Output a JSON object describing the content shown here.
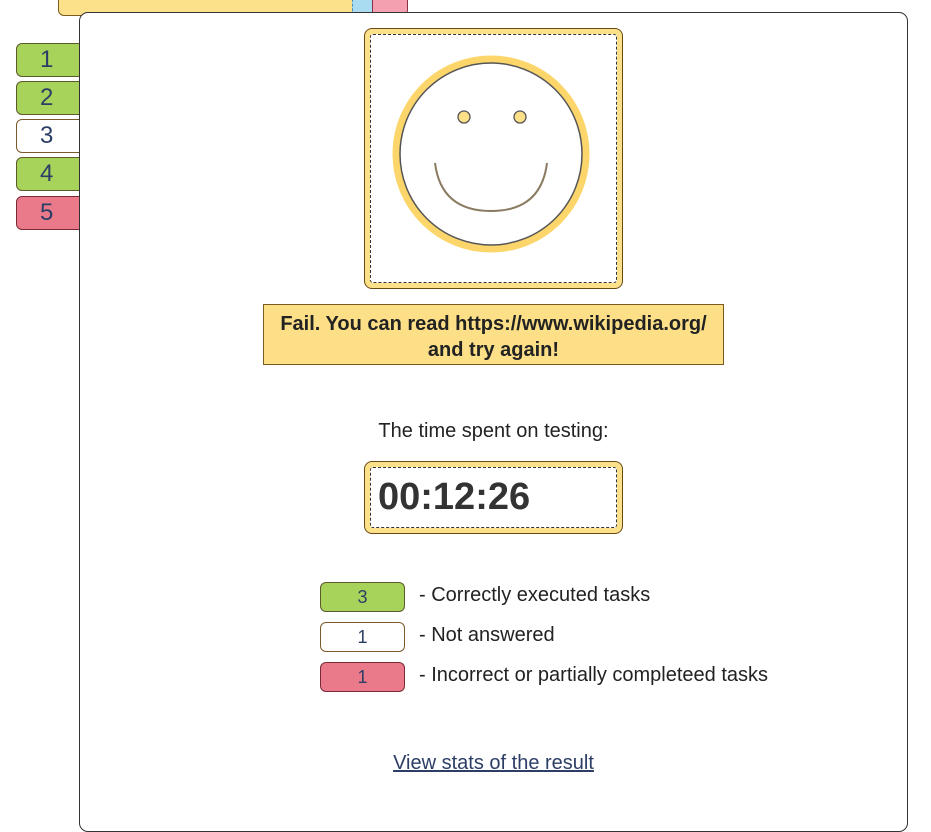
{
  "nav": {
    "tasks": [
      {
        "number": "1",
        "status": "correct"
      },
      {
        "number": "2",
        "status": "correct"
      },
      {
        "number": "3",
        "status": "not-answered"
      },
      {
        "number": "4",
        "status": "correct"
      },
      {
        "number": "5",
        "status": "incorrect"
      }
    ]
  },
  "result": {
    "smiley_icon": "smiley-face-icon",
    "message_line1": "Fail. You can read https://www.wikipedia.org/",
    "message_line2": "and try again!",
    "time_label": "The time spent on testing:",
    "time_value": "00:12:26"
  },
  "legend": [
    {
      "count": "3",
      "text": "- Correctly executed tasks",
      "status": "correct"
    },
    {
      "count": "1",
      "text": "- Not answered",
      "status": "not-answered"
    },
    {
      "count": "1",
      "text": "- Incorrect or partially completeed tasks",
      "status": "incorrect"
    }
  ],
  "stats_link": "View stats of the result",
  "colors": {
    "correct": "#a8d35a",
    "incorrect": "#ea7a8a",
    "not_answered": "#ffffff",
    "accent_yellow": "#fce08a",
    "link": "#2c3e66"
  }
}
